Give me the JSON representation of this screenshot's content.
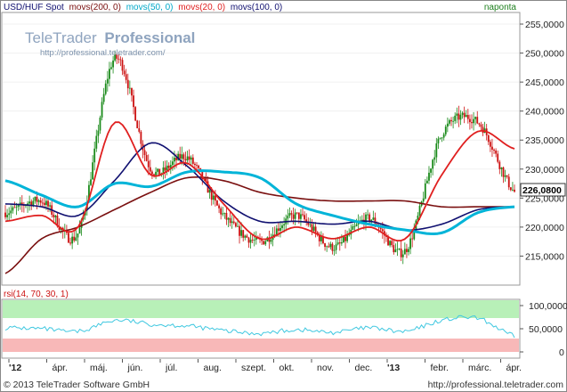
{
  "header": {
    "title": "USD/HUF Spot",
    "indicators": [
      "movs(200, 0)",
      "movs(50, 0)",
      "movs(20, 0)",
      "movs(100, 0)"
    ],
    "period": "naponta"
  },
  "watermark": {
    "brand_a": "TeleTrader",
    "brand_b": "Professional",
    "url": "http://professional.teletrader.com/"
  },
  "rsi": {
    "label": "rsi(14, 70, 30, 1)",
    "ticks": [
      "100,0000",
      "50,0000",
      "0"
    ],
    "band_upper": 70,
    "band_lower": 30
  },
  "price_axis": {
    "ticks": [
      "255,0000",
      "250,0000",
      "245,0000",
      "240,0000",
      "235,0000",
      "230,0000",
      "225,0000",
      "220,0000",
      "215,0000"
    ],
    "last_value": "226,0800"
  },
  "time_axis": [
    "'12",
    "ápr.",
    "máj.",
    "jún.",
    "júl.",
    "aug.",
    "szept.",
    "okt.",
    "nov.",
    "dec.",
    "'13",
    "febr.",
    "márc.",
    "ápr."
  ],
  "footer": {
    "copyright": "© 2013 TeleTrader Software GmbH",
    "url": "http://professional.teletrader.com"
  },
  "colors": {
    "price": "#cc0000",
    "bull_candle": "#1a8a1a",
    "bear_candle": "#cc1111",
    "movs200": "#7a1010",
    "movs50": "#00b4d8",
    "movs20": "#e02020",
    "movs100": "#101070",
    "rsi_line": "#40c8e0",
    "rsi_overbought": "#b8f0b8",
    "rsi_oversold": "#f8b8b8"
  },
  "chart_data": [
    {
      "type": "line",
      "title": "USD/HUF Spot",
      "x": [
        "'12",
        "ápr.",
        "máj.",
        "jún.",
        "júl.",
        "aug.",
        "szept.",
        "okt.",
        "nov.",
        "dec.",
        "'13",
        "febr.",
        "márc.",
        "ápr."
      ],
      "ylim": [
        210,
        257
      ],
      "series": [
        {
          "name": "USD/HUF Spot",
          "values": [
            222.5,
            224.5,
            219,
            249,
            230,
            232,
            222,
            217.5,
            222,
            216.5,
            221.5,
            216,
            236,
            238,
            226.08
          ]
        },
        {
          "name": "movs(20, 0)",
          "values": [
            221,
            222,
            220,
            238,
            229,
            231,
            224,
            218,
            220,
            218,
            220,
            218,
            229,
            236.5,
            233.5
          ]
        },
        {
          "name": "movs(50, 0)",
          "values": [
            228,
            225.5,
            223.5,
            227.5,
            227,
            229.5,
            229.5,
            228.5,
            224,
            222,
            220.5,
            219.5,
            219,
            222.5,
            223.5
          ]
        },
        {
          "name": "movs(100, 0)",
          "values": [
            224,
            223.5,
            222,
            228,
            234.5,
            230.5,
            224.5,
            221,
            221,
            220.5,
            221,
            219.5,
            220.5,
            223,
            223.5
          ]
        },
        {
          "name": "movs(200, 0)",
          "values": [
            212,
            218,
            220,
            223,
            226,
            228.5,
            228,
            226,
            225,
            224.5,
            224.5,
            224.5,
            223.5,
            223.5,
            223.5
          ]
        }
      ]
    },
    {
      "type": "line",
      "title": "rsi(14, 70, 30, 1)",
      "ylim": [
        0,
        100
      ],
      "series": [
        {
          "name": "rsi(14, 70, 30, 1)",
          "values": [
            52,
            50,
            44,
            68,
            60,
            56,
            46,
            40,
            48,
            42,
            52,
            44,
            68,
            72,
            34
          ]
        }
      ]
    }
  ]
}
